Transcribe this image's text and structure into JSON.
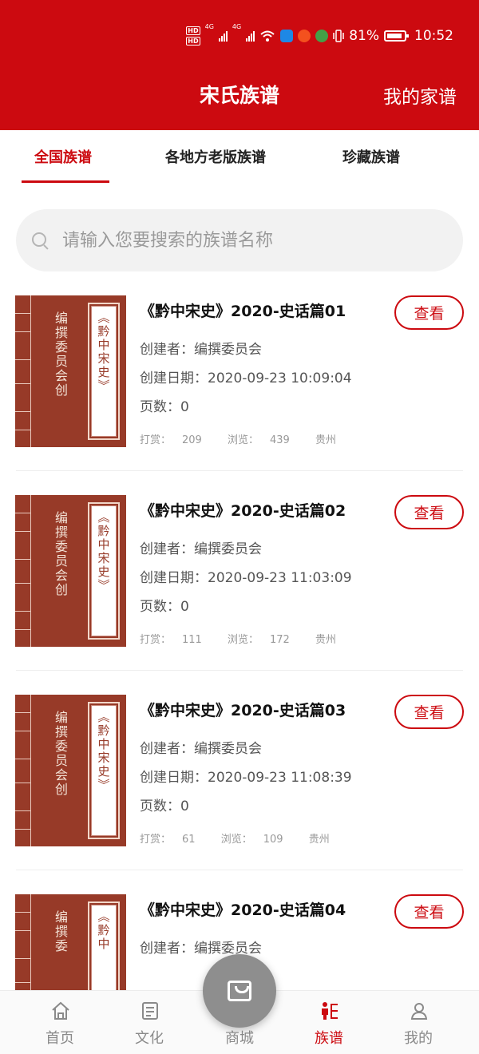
{
  "status_bar": {
    "hd1": "HD",
    "hd2": "HD",
    "sig1": "4G",
    "sig2": "4G",
    "battery_pct": "81%",
    "time": "10:52",
    "app_colors": [
      "#1e88e5",
      "#f4511e",
      "#43a047"
    ]
  },
  "header": {
    "title": "宋氏族谱",
    "right_link": "我的家谱",
    "bg_color": "#cc0a10"
  },
  "tabs": [
    {
      "label": "全国族谱",
      "active": true
    },
    {
      "label": "各地方老版族谱",
      "active": false
    },
    {
      "label": "珍藏族谱",
      "active": false
    }
  ],
  "search": {
    "placeholder": "请输入您要搜索的族谱名称",
    "icon": "search-icon"
  },
  "items": [
    {
      "cover_author": "编撰委员会创",
      "cover_title": "《黔中宋史》",
      "title": "《黔中宋史》2020-史话篇01",
      "button": "查看",
      "creator_label": "创建者：",
      "creator": "编撰委员会",
      "date_label": "创建日期：",
      "date": "2020-09-23 10:09:04",
      "pages_label": "页数：",
      "pages": "0",
      "reward_label": "打赏：",
      "reward": "209",
      "views_label": "浏览：",
      "views": "439",
      "region": "贵州"
    },
    {
      "cover_author": "编撰委员会创",
      "cover_title": "《黔中宋史》",
      "title": "《黔中宋史》2020-史话篇02",
      "button": "查看",
      "creator_label": "创建者：",
      "creator": "编撰委员会",
      "date_label": "创建日期：",
      "date": "2020-09-23 11:03:09",
      "pages_label": "页数：",
      "pages": "0",
      "reward_label": "打赏：",
      "reward": "111",
      "views_label": "浏览：",
      "views": "172",
      "region": "贵州"
    },
    {
      "cover_author": "编撰委员会创",
      "cover_title": "《黔中宋史》",
      "title": "《黔中宋史》2020-史话篇03",
      "button": "查看",
      "creator_label": "创建者：",
      "creator": "编撰委员会",
      "date_label": "创建日期：",
      "date": "2020-09-23 11:08:39",
      "pages_label": "页数：",
      "pages": "0",
      "reward_label": "打赏：",
      "reward": "61",
      "views_label": "浏览：",
      "views": "109",
      "region": "贵州"
    },
    {
      "cover_author": "编撰委",
      "cover_title": "《黔中",
      "title": "《黔中宋史》2020-史话篇04",
      "button": "查看",
      "creator_label": "创建者：",
      "creator": "编撰委员会"
    }
  ],
  "bottom_nav": [
    {
      "label": "首页",
      "icon": "home-icon",
      "active": false
    },
    {
      "label": "文化",
      "icon": "document-icon",
      "active": false
    },
    {
      "label": "商城",
      "icon": "shopping-bag-icon",
      "active": false
    },
    {
      "label": "族谱",
      "icon": "family-tree-icon",
      "active": true
    },
    {
      "label": "我的",
      "icon": "user-icon",
      "active": false
    }
  ]
}
